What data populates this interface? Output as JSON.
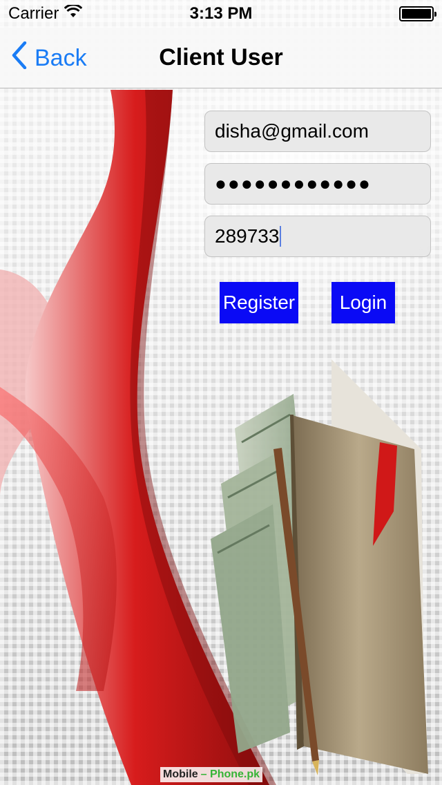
{
  "status_bar": {
    "carrier": "Carrier",
    "time": "3:13 PM",
    "wifi_icon": "wifi-icon",
    "battery_icon": "battery-icon"
  },
  "nav": {
    "back_label": "Back",
    "title": "Client User",
    "back_icon": "chevron-left-icon"
  },
  "form": {
    "email_value": "disha@gmail.com",
    "password_value": "●●●●●●●●●●●●",
    "code_value": "289733",
    "register_label": "Register",
    "login_label": "Login"
  },
  "watermark": {
    "part1": "Mobile",
    "part2": "– Phone.pk"
  },
  "colors": {
    "accent": "#1a7cf5",
    "button_bg": "#0a0af5",
    "button_text": "#ffffff",
    "ribbon_red": "#d01818"
  }
}
